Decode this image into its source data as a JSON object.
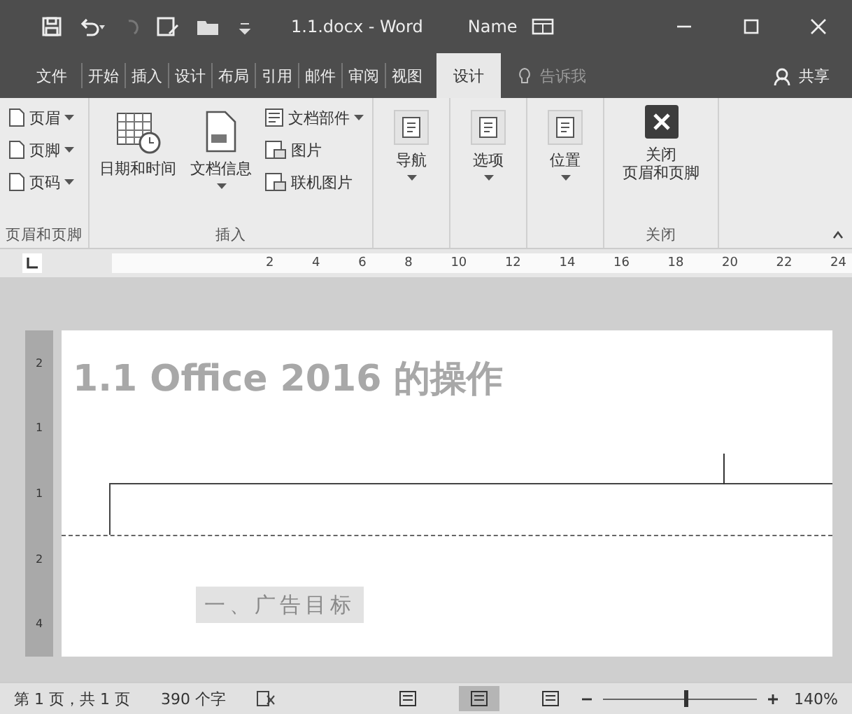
{
  "window": {
    "title": "1.1.docx - Word",
    "user": "Name"
  },
  "tabs": [
    {
      "label": "文件",
      "selected": false
    },
    {
      "label": "开始",
      "selected": false
    },
    {
      "label": "插入",
      "selected": false
    },
    {
      "label": "设计",
      "selected": false
    },
    {
      "label": "布局",
      "selected": false
    },
    {
      "label": "引用",
      "selected": false
    },
    {
      "label": "邮件",
      "selected": false
    },
    {
      "label": "审阅",
      "selected": false
    },
    {
      "label": "视图",
      "selected": false
    },
    {
      "label": "设计",
      "selected": true
    }
  ],
  "tell_me": {
    "placeholder": "告诉我"
  },
  "share": "共享",
  "ribbon_groups": [
    {
      "name": "页眉和页脚",
      "items": [
        {
          "kind": "small",
          "lines": [
            "页眉"
          ],
          "dropdown": true
        },
        {
          "kind": "small",
          "lines": [
            "页脚"
          ],
          "dropdown": true
        },
        {
          "kind": "small",
          "lines": [
            "页码"
          ],
          "dropdown": true
        }
      ]
    },
    {
      "name": "插入",
      "items": [
        {
          "kind": "large",
          "lines": [
            "日期和时间"
          ],
          "dropdown": false
        },
        {
          "kind": "large",
          "lines": [
            "文档信息"
          ],
          "dropdown": true
        },
        {
          "kind": "small",
          "lines": [
            "文档部件"
          ],
          "dropdown": true
        },
        {
          "kind": "small",
          "lines": [
            "图片"
          ],
          "dropdown": false
        },
        {
          "kind": "small",
          "lines": [
            "联机图片"
          ],
          "dropdown": false
        }
      ]
    },
    {
      "items": [
        {
          "kind": "large",
          "lines": [
            "导航"
          ],
          "dropdown": true
        }
      ]
    },
    {
      "items": [
        {
          "kind": "large",
          "lines": [
            "选项"
          ],
          "dropdown": true
        }
      ]
    },
    {
      "items": [
        {
          "kind": "large",
          "lines": [
            "位置"
          ],
          "dropdown": true
        }
      ]
    },
    {
      "name": "关闭",
      "items": [
        {
          "kind": "large",
          "lines": [
            "关闭",
            "页眉和页脚"
          ],
          "dropdown": false
        }
      ]
    }
  ],
  "ruler": [
    "2",
    "4",
    "6",
    "8",
    "10",
    "12",
    "14",
    "16",
    "18",
    "20",
    "22",
    "24"
  ],
  "vertical_ruler": [
    "2",
    "1",
    "1",
    "2",
    "4"
  ],
  "document": {
    "faded_heading": "1.1 Office 2016 的操作",
    "body_text": "一、广告目标"
  },
  "status_bar": {
    "page": "第 1 页，共 1 页",
    "words": "390 个字",
    "views": [
      {
        "selected": false
      },
      {
        "selected": true
      },
      {
        "selected": false
      }
    ],
    "level": 0.53,
    "zoom": "140%"
  }
}
